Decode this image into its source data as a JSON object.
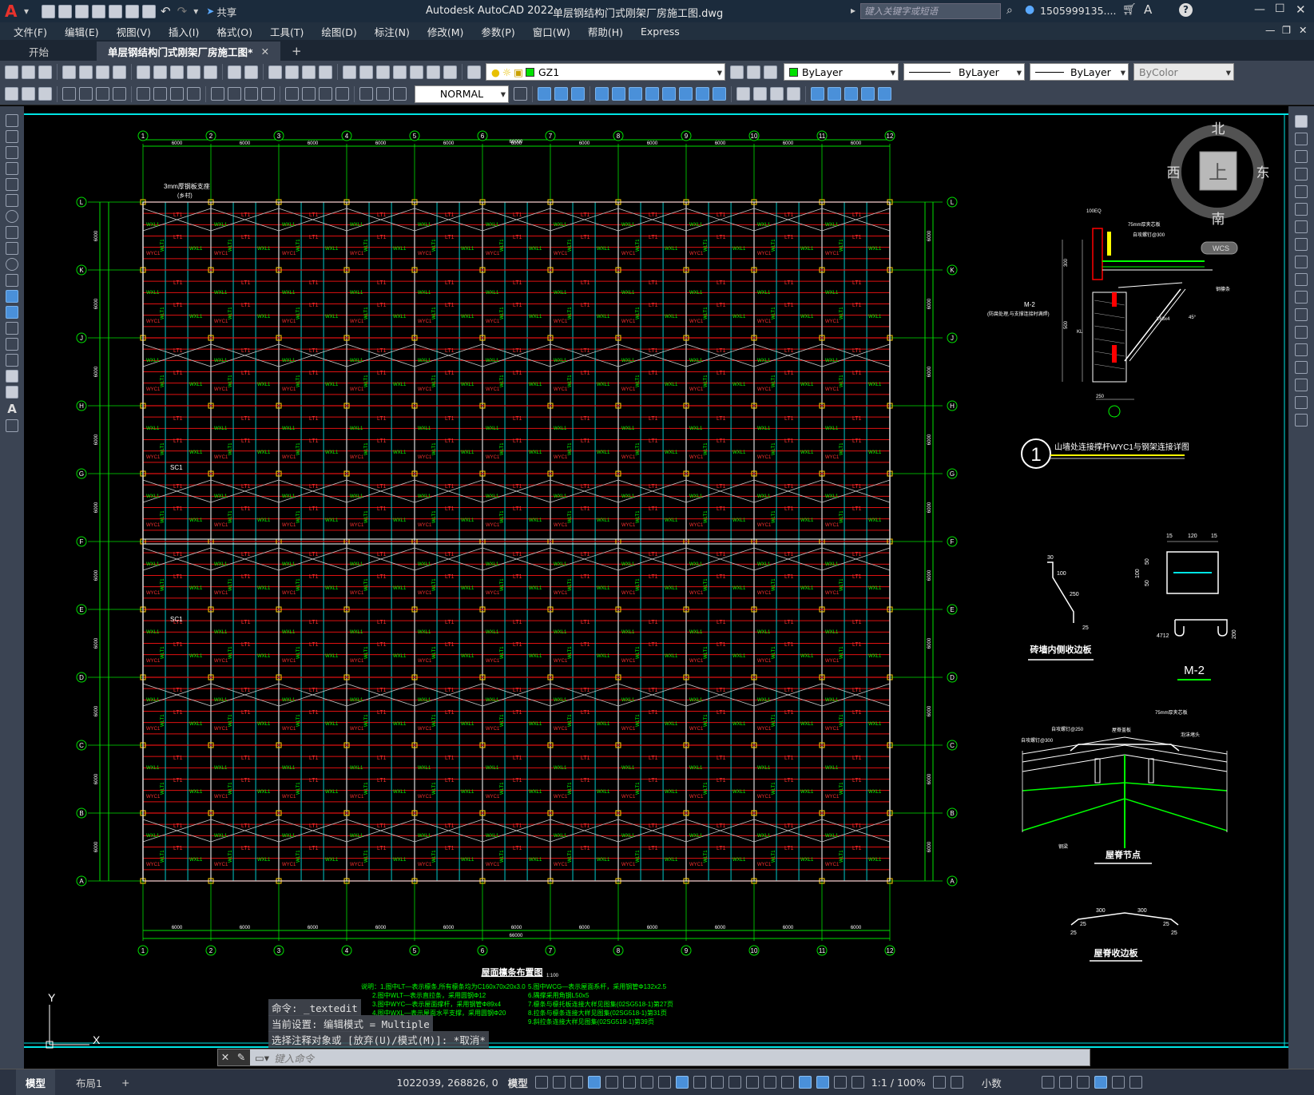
{
  "app": {
    "title": "Autodesk AutoCAD 2022",
    "filename": "单层钢结构门式刚架厂房施工图.dwg",
    "share_label": "共享",
    "search_placeholder": "键入关键字或短语",
    "user": "1505999135...."
  },
  "menu": [
    "文件(F)",
    "编辑(E)",
    "视图(V)",
    "插入(I)",
    "格式(O)",
    "工具(T)",
    "绘图(D)",
    "标注(N)",
    "修改(M)",
    "参数(P)",
    "窗口(W)",
    "帮助(H)",
    "Express"
  ],
  "tabs": [
    {
      "label": "开始"
    },
    {
      "label": "单层钢结构门式刚架厂房施工图*"
    }
  ],
  "toolbar": {
    "layer": "GZ1",
    "visual_style": "NORMAL",
    "color": "ByLayer",
    "linetype": "ByLayer",
    "lineweight": "ByLayer",
    "plotstyle": "ByColor"
  },
  "viewcube": {
    "north": "北",
    "south": "南",
    "west": "西",
    "east": "东",
    "top": "上",
    "wcs": "WCS"
  },
  "drawing": {
    "grid_cols": [
      "1",
      "2",
      "3",
      "4",
      "5",
      "6",
      "7",
      "8",
      "9",
      "10",
      "11",
      "12"
    ],
    "grid_rows": [
      "L",
      "K",
      "J",
      "H",
      "G",
      "F",
      "E",
      "D",
      "C",
      "B",
      "A"
    ],
    "bay_spacing": "6000",
    "total_length": "66000",
    "plan_title": "屋面檩条布置图",
    "plan_scale": "1:100",
    "member_labels": {
      "purlin": "LT1",
      "rafter": "WXL1",
      "tie": "WYC1",
      "brace": "WXG1",
      "column": "WLT1",
      "sc": "SC1"
    },
    "top_note": "3mm厚钢板支座",
    "top_note_sub": "(乡村)",
    "notes": [
      "说明：1.图中LT—表示檩条,所有檩条均为C160x70x20x3.0",
      "2.图中WLT—表示直拉条，采用圆钢Φ12",
      "3.图中WYC—表示屋面撑杆，采用钢管Φ89x4",
      "4.图中WXL—表示屋面水平支撑，采用圆钢Φ20",
      "5.图中WCG—表示屋面系杆，采用钢管Φ132x2.5",
      "6.隅撑采用角钢L50x5",
      "7.檩条与檩托板连接大样见图集(02SG518-1)第27页",
      "8.拉条与檩条连接大样见图集(02SG518-1)第31页",
      "9.斜拉条连接大样见图集(02SG518-1)第39页"
    ],
    "detail1_title": "山墙处连接撑杆WYC1与钢架连接详图",
    "detail1_num": "1",
    "detail1_labels": [
      "100EQ",
      "75mm厚夹芯板",
      "自攻螺钉@300",
      "M-2",
      "(防腐处理,与支撑连接时满焊)",
      "KL",
      "L63x4",
      "45°",
      "钢檩条",
      "300",
      "500",
      "250"
    ],
    "detail2_title": "砖墙内侧收边板",
    "detail2_dims": [
      "30",
      "100",
      "250",
      "25"
    ],
    "detail3_title": "M-2",
    "detail3_dims": [
      "15",
      "120",
      "15",
      "50",
      "50",
      "100",
      "4712",
      "200"
    ],
    "detail4_title": "屋脊节点",
    "detail4_labels": [
      "75mm厚夹芯板",
      "自攻螺钉@250",
      "屋脊盖板",
      "泡沫堵头",
      "自攻螺钉@300",
      "钢梁"
    ],
    "detail5_title": "屋脊收边板",
    "detail5_dims": [
      "300",
      "300",
      "25",
      "25",
      "25",
      "25"
    ]
  },
  "command": {
    "history": [
      "命令: _textedit",
      "当前设置: 编辑模式 = Multiple",
      "选择注释对象或 [放弃(U)/模式(M)]: *取消*"
    ],
    "placeholder": "键入命令"
  },
  "status": {
    "model_tab": "模型",
    "layout_tab": "布局1",
    "coords": "1022039, 268826, 0",
    "mode": "模型",
    "scale": "1:1 / 100%",
    "units": "小数"
  }
}
